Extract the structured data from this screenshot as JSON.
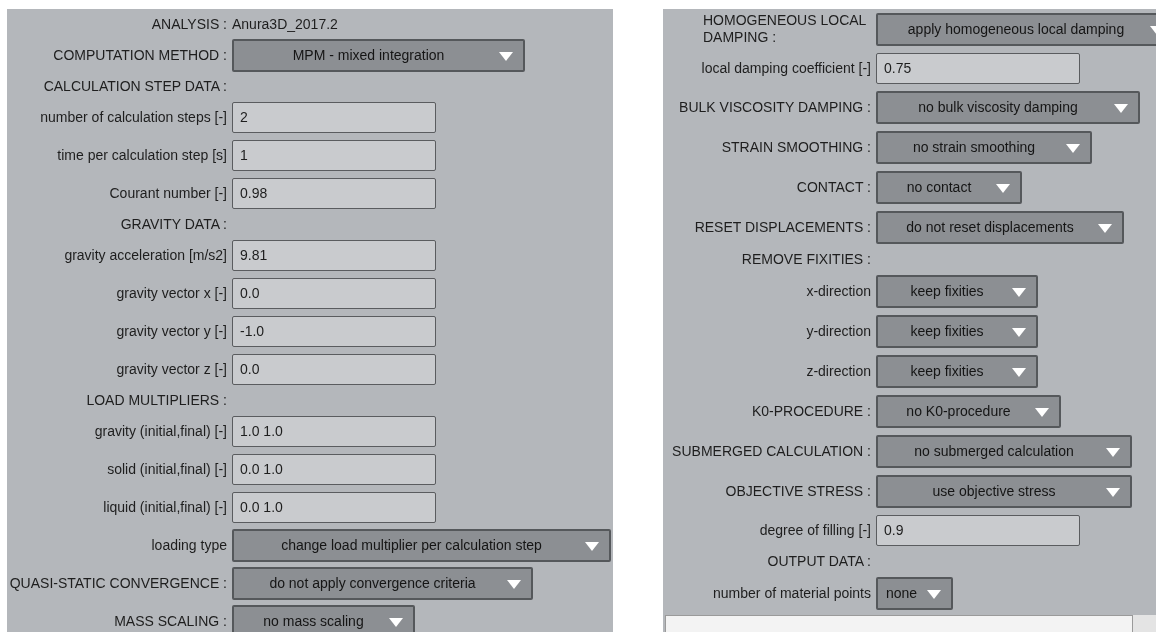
{
  "left_panel": {
    "rows": [
      {
        "kind": "info",
        "label": "ANALYSIS :",
        "value": "Anura3D_2017.2"
      },
      {
        "kind": "dropdown",
        "label": "COMPUTATION METHOD :",
        "value": "MPM - mixed integration"
      },
      {
        "kind": "heading",
        "label": "CALCULATION STEP DATA :"
      },
      {
        "kind": "input",
        "label": "number of calculation steps [-]",
        "value": "2"
      },
      {
        "kind": "input",
        "label": "time per calculation step [s]",
        "value": "1"
      },
      {
        "kind": "input",
        "label": "Courant number [-]",
        "value": "0.98"
      },
      {
        "kind": "heading",
        "label": "GRAVITY DATA :"
      },
      {
        "kind": "input",
        "label": "gravity acceleration [m/s2]",
        "value": "9.81"
      },
      {
        "kind": "input",
        "label": "gravity vector x [-]",
        "value": "0.0"
      },
      {
        "kind": "input",
        "label": "gravity vector y [-]",
        "value": "-1.0"
      },
      {
        "kind": "input",
        "label": "gravity vector z [-]",
        "value": "0.0"
      },
      {
        "kind": "heading",
        "label": "LOAD MULTIPLIERS :"
      },
      {
        "kind": "input",
        "label": "gravity (initial,final) [-]",
        "value": "1.0  1.0"
      },
      {
        "kind": "input",
        "label": "solid (initial,final) [-]",
        "value": "0.0  1.0"
      },
      {
        "kind": "input",
        "label": "liquid (initial,final) [-]",
        "value": "0.0  1.0"
      },
      {
        "kind": "dropdown",
        "label": "loading type",
        "value": "change load multiplier per calculation step"
      },
      {
        "kind": "dropdown",
        "label": "QUASI-STATIC CONVERGENCE :",
        "value": "do not apply convergence criteria"
      },
      {
        "kind": "dropdown",
        "label": "MASS SCALING :",
        "value": "no mass scaling"
      }
    ]
  },
  "right_panel": {
    "rows": [
      {
        "kind": "dropdown",
        "label": "HOMOGENEOUS LOCAL DAMPING :",
        "value": "apply homogeneous local damping"
      },
      {
        "kind": "input",
        "label": "local damping coefficient [-]",
        "value": "0.75"
      },
      {
        "kind": "dropdown",
        "label": "BULK VISCOSITY DAMPING :",
        "value": "no bulk viscosity damping"
      },
      {
        "kind": "dropdown",
        "label": "STRAIN SMOOTHING :",
        "value": "no strain smoothing"
      },
      {
        "kind": "dropdown",
        "label": "CONTACT :",
        "value": "no contact"
      },
      {
        "kind": "dropdown",
        "label": "RESET DISPLACEMENTS :",
        "value": "do not reset displacements"
      },
      {
        "kind": "heading",
        "label": "REMOVE FIXITIES :"
      },
      {
        "kind": "dropdown",
        "label": "x-direction",
        "value": "keep fixities"
      },
      {
        "kind": "dropdown",
        "label": "y-direction",
        "value": "keep fixities"
      },
      {
        "kind": "dropdown",
        "label": "z-direction",
        "value": "keep fixities"
      },
      {
        "kind": "dropdown",
        "label": "K0-PROCEDURE :",
        "value": "no K0-procedure"
      },
      {
        "kind": "dropdown",
        "label": "SUBMERGED CALCULATION :",
        "value": "no submerged calculation"
      },
      {
        "kind": "dropdown",
        "label": "OBJECTIVE STRESS :",
        "value": "use objective stress"
      },
      {
        "kind": "input",
        "label": "degree of filling [-]",
        "value": "0.9"
      },
      {
        "kind": "heading",
        "label": "OUTPUT DATA :"
      },
      {
        "kind": "dropdown",
        "label": "number of material points",
        "value": "none"
      }
    ]
  }
}
